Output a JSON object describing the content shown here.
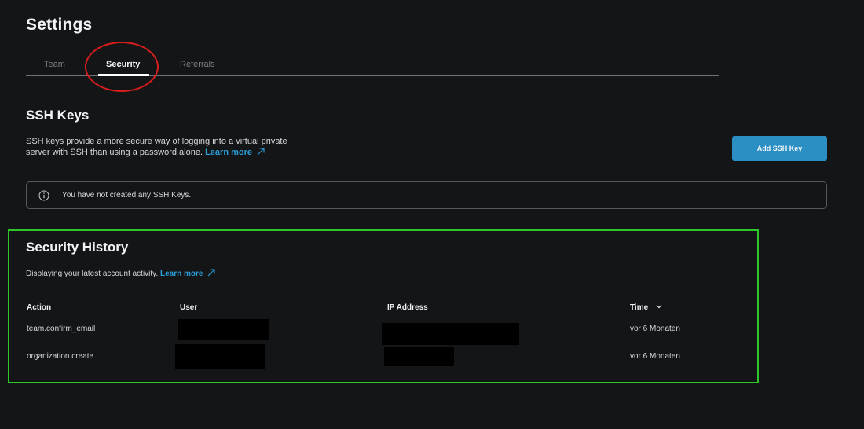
{
  "page": {
    "title": "Settings"
  },
  "tabs": [
    {
      "label": "Team"
    },
    {
      "label": "Security"
    },
    {
      "label": "Referrals"
    }
  ],
  "ssh_keys": {
    "title": "SSH Keys",
    "description": "SSH keys provide a more secure way of logging into a virtual private server with SSH than using a password alone.",
    "learn_more": "Learn more",
    "add_button": "Add SSH Key",
    "empty_notice": "You have not created any SSH Keys."
  },
  "security_history": {
    "title": "Security History",
    "description": "Displaying your latest account activity.",
    "learn_more": "Learn more",
    "columns": {
      "action": "Action",
      "user": "User",
      "ip": "IP Address",
      "time": "Time"
    },
    "rows": [
      {
        "action": "team.confirm_email",
        "time": "vor 6 Monaten"
      },
      {
        "action": "organization.create",
        "time": "vor 6 Monaten"
      }
    ]
  },
  "colors": {
    "background": "#141517",
    "accent": "#2b8fc4",
    "link": "#2b9fd9",
    "annotation_red": "#d71d1d",
    "annotation_green": "#2fc62a"
  },
  "icons": [
    "info-icon",
    "external-link-arrow-icon",
    "chevron-down-icon"
  ]
}
